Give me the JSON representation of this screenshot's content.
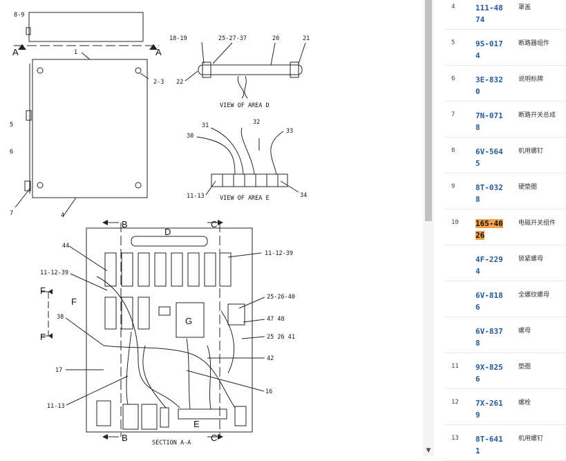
{
  "diagram": {
    "callouts": {
      "c8_9": "8-9",
      "c1": "1",
      "c2_3": "2-3",
      "c5": "5",
      "c6": "6",
      "c7": "7",
      "c4": "4",
      "sectionA_left": "A",
      "sectionA_right": "A",
      "c18_19": "18-19",
      "c25_27_37": "25-27-37",
      "c20": "20",
      "c21": "21",
      "c22": "22",
      "viewD": "VIEW OF AREA D",
      "c31": "31",
      "c32": "32",
      "c30": "30",
      "c33": "33",
      "c11_13_top": "11-13",
      "c34": "34",
      "viewE": "VIEW OF AREA E",
      "B_top": "B",
      "D_top": "D",
      "C_top": "C",
      "c44": "44",
      "c11_12_39_right": "11-12-39",
      "c11_12_39_left": "11-12-39",
      "F_top": "F",
      "F_mid": "F",
      "F_bot": "F",
      "c25_26_40": "25-26-40",
      "c47_48": "47 48",
      "G": "G",
      "c38": "38",
      "c25_26_41": "25 26 41",
      "c42": "42",
      "c17": "17",
      "c16": "16",
      "c11_13_bottom": "11-13",
      "E": "E",
      "B_bot": "B",
      "C_bot": "C",
      "section": "SECTION A-A"
    }
  },
  "parts": [
    {
      "no": "4",
      "pn": "111-4874",
      "desc": "罩盖"
    },
    {
      "no": "5",
      "pn": "9S-0174",
      "desc": "断路器组件"
    },
    {
      "no": "6",
      "pn": "3E-8320",
      "desc": "说明标牌"
    },
    {
      "no": "7",
      "pn": "7N-0718",
      "desc": "断路开关总成"
    },
    {
      "no": "8",
      "pn": "6V-5645",
      "desc": "机用螺钉"
    },
    {
      "no": "9",
      "pn": "8T-0328",
      "desc": "硬垫圈"
    },
    {
      "no": "10",
      "pn": "165-4026",
      "desc": "电磁开关组件",
      "highlight": true
    },
    {
      "no": "",
      "pn": "4F-2294",
      "desc": "锁紧螺母"
    },
    {
      "no": "",
      "pn": "6V-8186",
      "desc": "全螺纹螺母"
    },
    {
      "no": "",
      "pn": "6V-8378",
      "desc": "螺母"
    },
    {
      "no": "11",
      "pn": "9X-8256",
      "desc": "垫圈"
    },
    {
      "no": "12",
      "pn": "7X-2619",
      "desc": "螺栓"
    },
    {
      "no": "13",
      "pn": "8T-6411",
      "desc": "机用螺钉"
    }
  ],
  "scrollbar": {
    "arrow": "▼"
  }
}
